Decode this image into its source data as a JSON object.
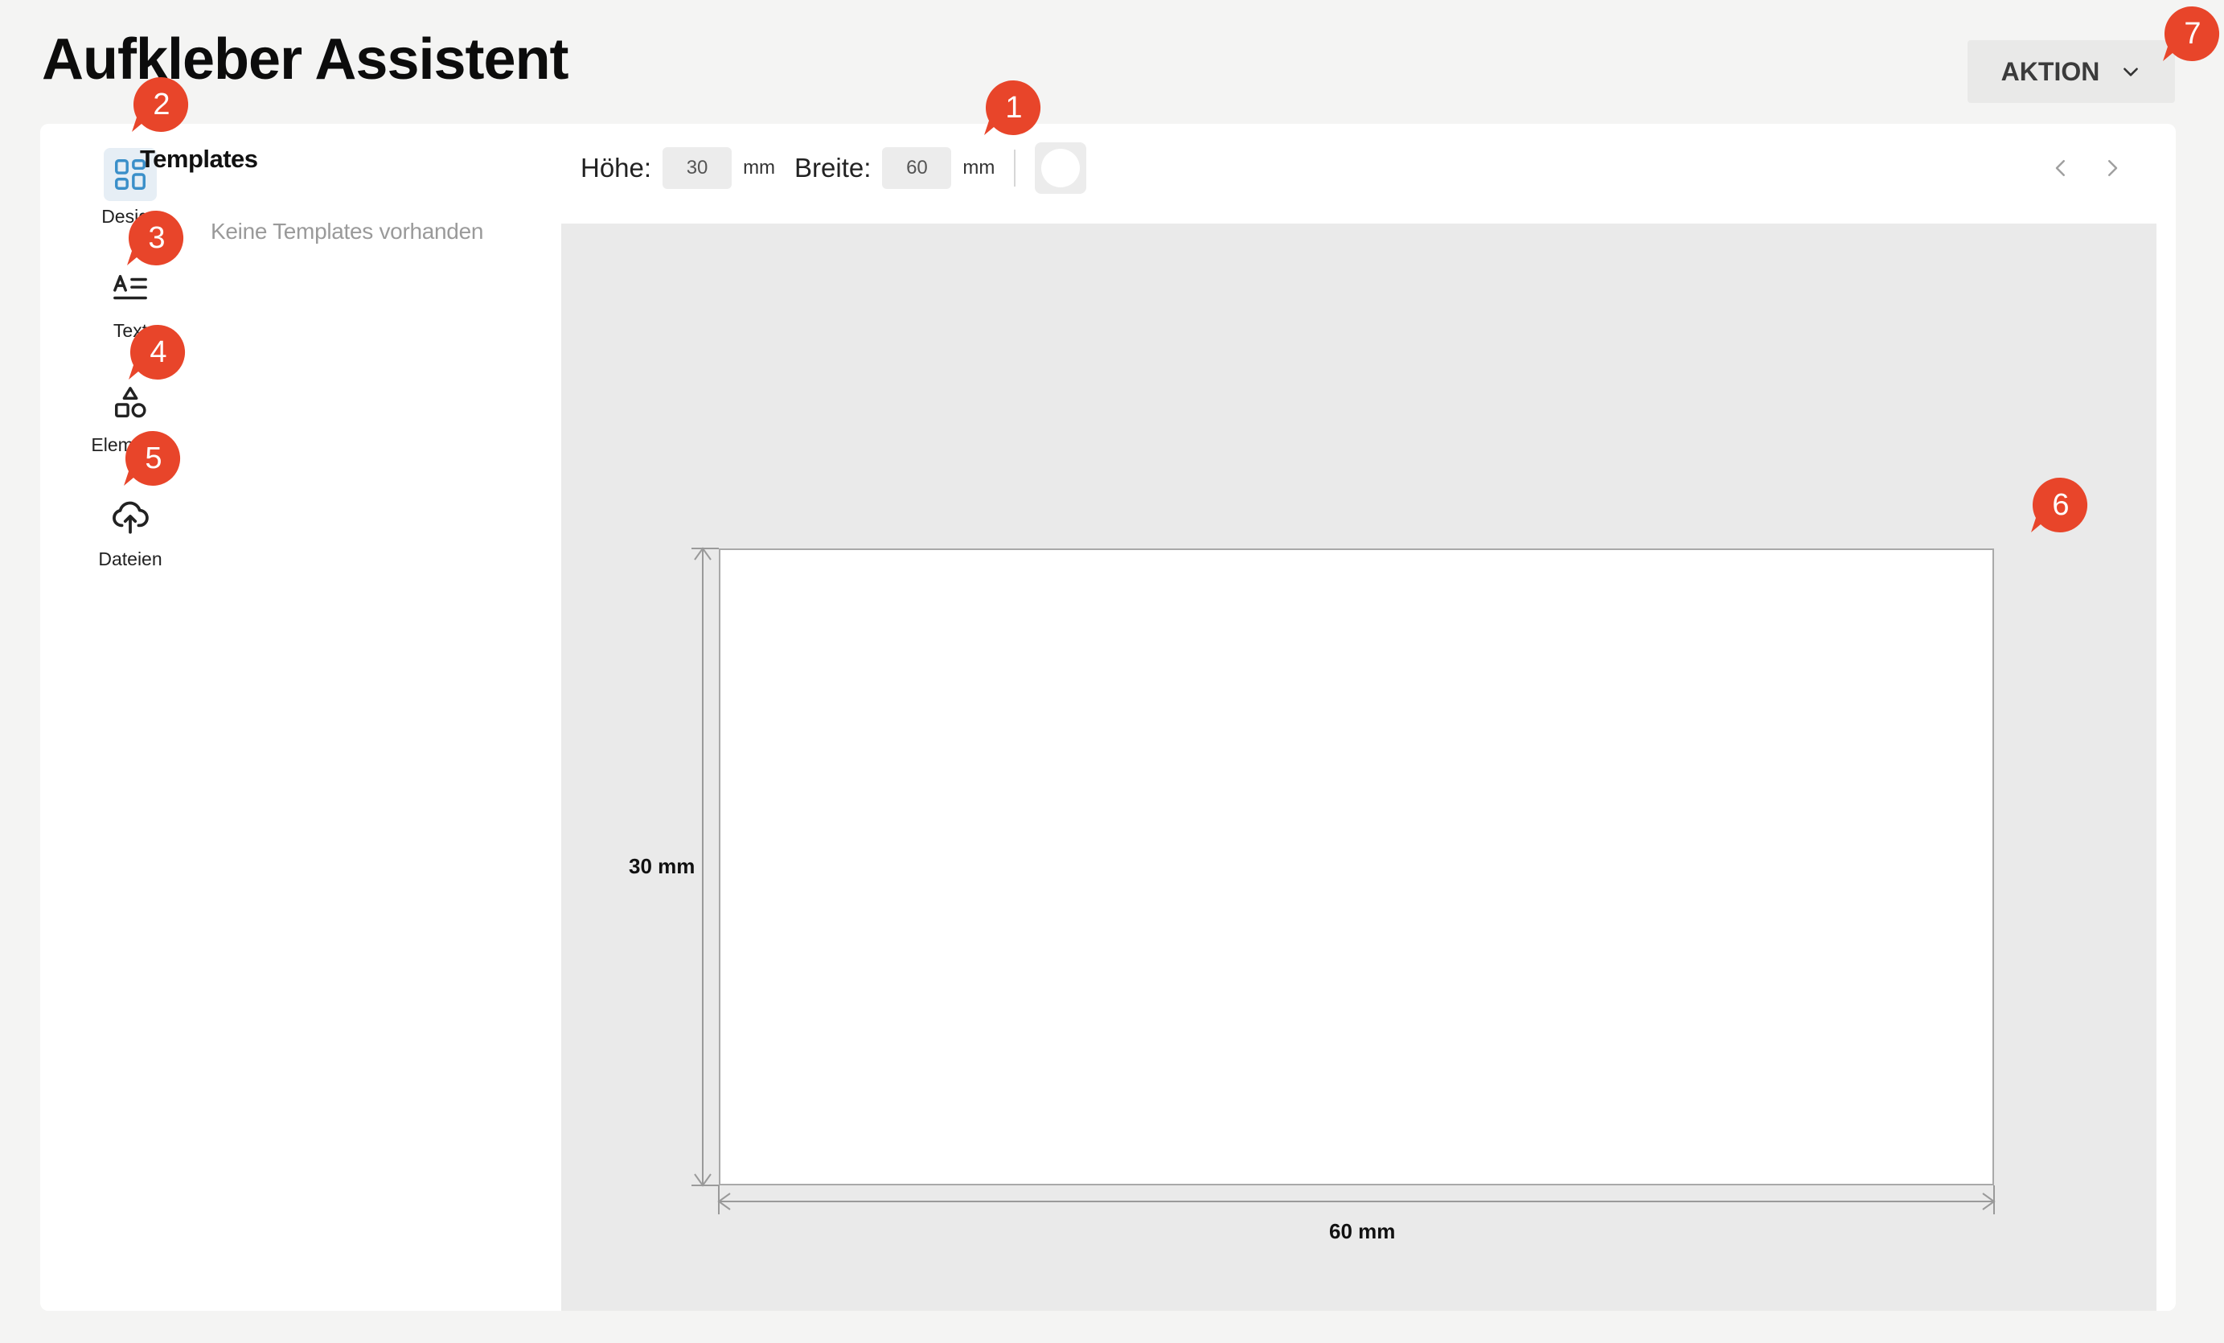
{
  "app": {
    "title": "Aufkleber Assistent",
    "action_label": "AKTION"
  },
  "sidebar": {
    "items": [
      {
        "label": "Design",
        "icon": "layout-grid-icon",
        "active": true
      },
      {
        "label": "Text",
        "icon": "text-format-icon",
        "active": false
      },
      {
        "label": "Elemente",
        "icon": "shapes-icon",
        "active": false
      },
      {
        "label": "Dateien",
        "icon": "cloud-upload-icon",
        "active": false
      }
    ]
  },
  "templates": {
    "title": "Templates",
    "empty_message": "Keine Templates vorhanden"
  },
  "toolbar": {
    "height_label": "Höhe:",
    "height_value": "30",
    "height_unit": "mm",
    "width_label": "Breite:",
    "width_value": "60",
    "width_unit": "mm",
    "shape": "circle"
  },
  "canvas": {
    "height_dimension": "30 mm",
    "width_dimension": "60 mm"
  },
  "annotations": [
    "1",
    "2",
    "3",
    "4",
    "5",
    "6",
    "7"
  ],
  "colors": {
    "marker": "#e8452a",
    "accent_icon": "#3a8fc9",
    "canvas_bg": "#eaeaea",
    "page_bg": "#f4f4f3"
  }
}
